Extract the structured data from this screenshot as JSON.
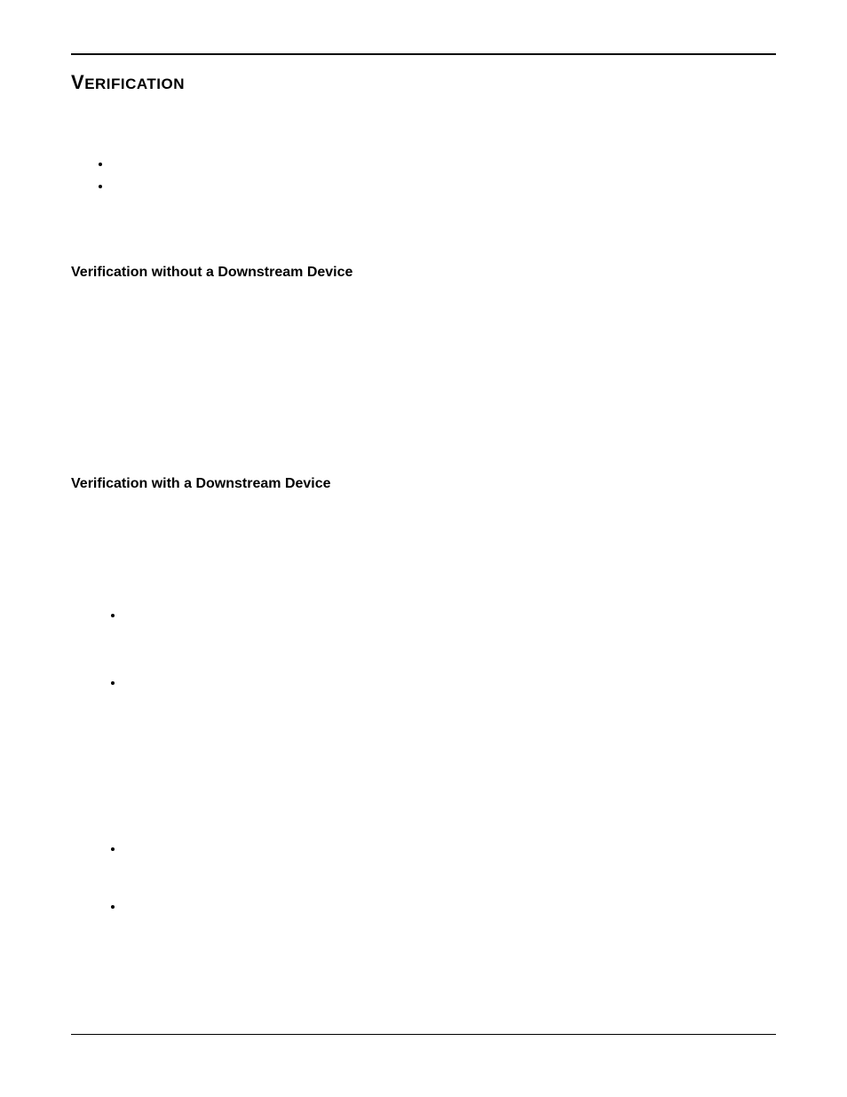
{
  "section": {
    "title": "Verification"
  },
  "sub1": {
    "title": "Verification without a Downstream Device"
  },
  "sub2": {
    "title": "Verification with a Downstream Device"
  }
}
